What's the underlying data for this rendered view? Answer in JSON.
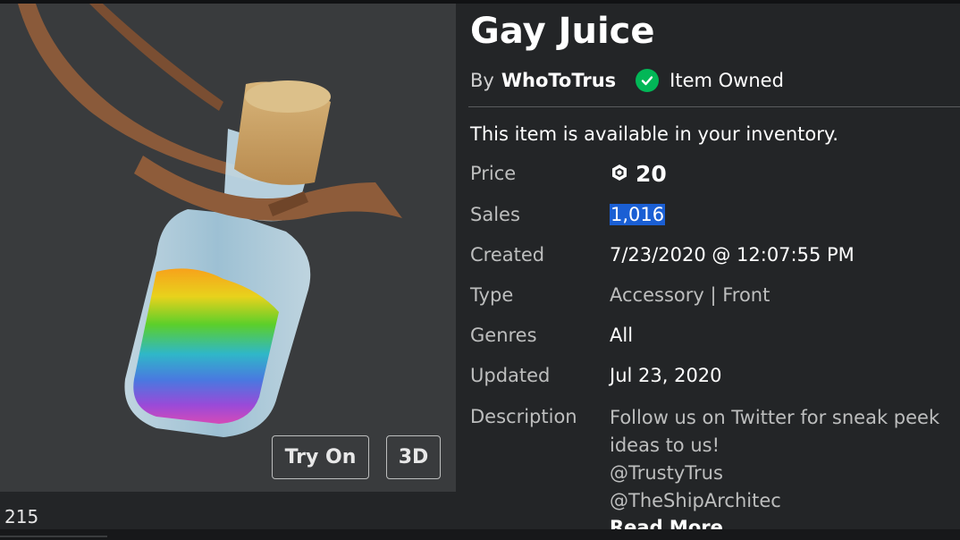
{
  "item": {
    "title": "Gay Juice",
    "by_label": "By",
    "creator": "WhoToTrus",
    "owned_label": "Item Owned",
    "inventory_note": "This item is available in your inventory."
  },
  "thumbnail": {
    "try_on_label": "Try On",
    "view_3d_label": "3D"
  },
  "details": {
    "price_label": "Price",
    "price_value": "20",
    "price_icon": "robux-icon",
    "sales_label": "Sales",
    "sales_value": "1,016",
    "created_label": "Created",
    "created_value": "7/23/2020 @ 12:07:55 PM",
    "type_label": "Type",
    "type_value": "Accessory | Front",
    "genres_label": "Genres",
    "genres_value": "All",
    "updated_label": "Updated",
    "updated_value": "Jul 23, 2020",
    "description_label": "Description",
    "description_lines": [
      "Follow us on Twitter for sneak peek",
      "ideas to us!",
      "@TrustyTrus",
      "@TheShipArchitec"
    ],
    "read_more_label": "Read More"
  },
  "footer": {
    "counter": "215"
  },
  "colors": {
    "background": "#232527",
    "thumbnail_bg": "#393b3d",
    "owned_green": "#02b757",
    "selection_blue": "#1a5fd4",
    "muted_text": "#bdbebe"
  }
}
